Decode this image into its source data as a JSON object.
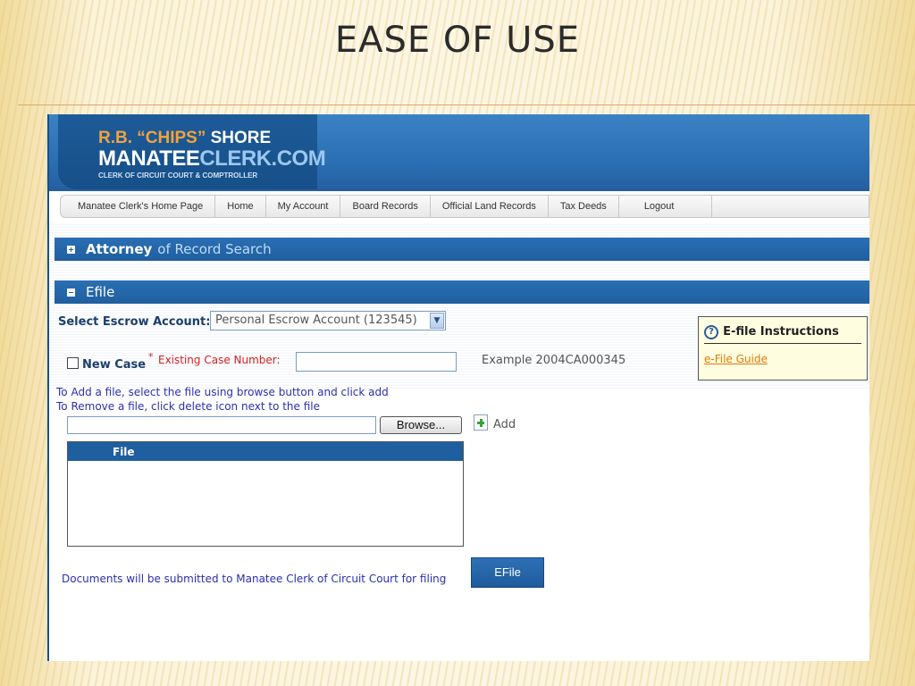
{
  "slide": {
    "title": "EASE OF USE"
  },
  "logo": {
    "line1a": "R.B. “CHIPS”",
    "line1b": " SHORE",
    "line2a": "MANATEE",
    "line2b": "CLERK.COM",
    "line3": "CLERK OF CIRCUIT COURT & COMPTROLLER"
  },
  "nav": {
    "items": [
      "Manatee Clerk's Home Page",
      "Home",
      "My Account",
      "Board Records",
      "Official Land Records",
      "Tax Deeds",
      "Logout"
    ]
  },
  "sections": {
    "attorney": {
      "bold": "Attorney",
      "rest": "of Record Search"
    },
    "efile": {
      "title": "Efile"
    }
  },
  "form": {
    "escrow_label": "Select Escrow Account:",
    "escrow_selected": "Personal Escrow Account (123545)",
    "new_case_label": "New Case",
    "required_mark": "*",
    "case_number_label": "Existing Case Number:",
    "case_number_value": "",
    "example_text": "Example 2004CA000345",
    "instructions_line1": "To Add a file, select the file using browse button and click add",
    "instructions_line2": "To Remove a file, click delete icon next to the file",
    "file_path_value": "",
    "browse_label": "Browse...",
    "add_label": "Add",
    "file_column": "File",
    "submit_note": "Documents will be submitted to Manatee Clerk of Circuit Court for filing",
    "efile_button": "EFile"
  },
  "help": {
    "icon": "?",
    "title": "E-file Instructions",
    "link": "e-File Guide"
  },
  "icons": [
    "plus-toggle-icon",
    "minus-toggle-icon",
    "dropdown-arrow-icon",
    "help-icon",
    "add-file-icon"
  ],
  "colors": {
    "bar_blue": "#1f5f9f",
    "banner_blue": "#2b6fb4",
    "logo_orange": "#f2a33a",
    "link_orange": "#e07a00",
    "text_blue": "#2a2fb0"
  }
}
